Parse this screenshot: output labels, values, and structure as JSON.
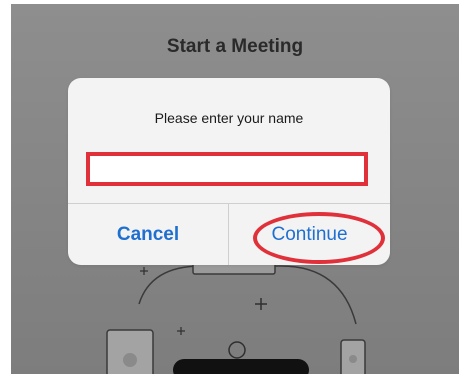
{
  "page": {
    "title": "Start a Meeting"
  },
  "dialog": {
    "message": "Please enter your name",
    "name_input": {
      "value": "",
      "placeholder": ""
    },
    "cancel_label": "Cancel",
    "continue_label": "Continue"
  },
  "colors": {
    "accent_blue": "#1f6fd1",
    "highlight_red": "#e0313a",
    "dim_background": "#878787",
    "dialog_background": "#f3f3f3"
  },
  "icons": {
    "illustration": "participants-circle-illustration",
    "plus": "plus-icon",
    "device": "phone-device-icon",
    "person": "person-icon"
  }
}
